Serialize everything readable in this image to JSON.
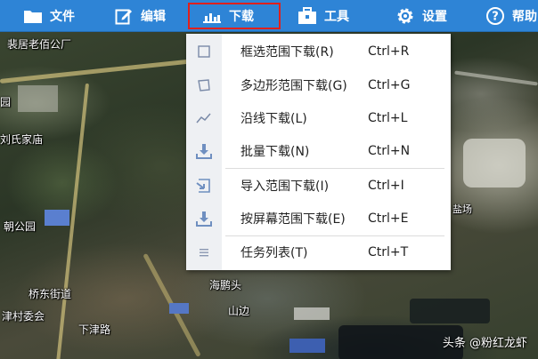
{
  "toolbar": {
    "items": [
      {
        "label": "文件",
        "icon": "folder-icon"
      },
      {
        "label": "编辑",
        "icon": "edit-icon"
      },
      {
        "label": "下载",
        "icon": "download-chart-icon",
        "active": true
      },
      {
        "label": "工具",
        "icon": "toolbox-icon"
      },
      {
        "label": "设置",
        "icon": "gear-icon"
      },
      {
        "label": "帮助",
        "icon": "help-icon"
      }
    ],
    "color": "#2e84d6",
    "highlight_color": "#e0201c"
  },
  "download_menu": {
    "items": [
      {
        "label": "框选范围下载(R)",
        "shortcut": "Ctrl+R",
        "icon": "rectangle-select-icon"
      },
      {
        "label": "多边形范围下载(G)",
        "shortcut": "Ctrl+G",
        "icon": "polygon-select-icon"
      },
      {
        "label": "沿线下载(L)",
        "shortcut": "Ctrl+L",
        "icon": "polyline-icon"
      },
      {
        "label": "批量下载(N)",
        "shortcut": "Ctrl+N",
        "icon": "batch-download-icon"
      },
      {
        "label": "导入范围下载(I)",
        "shortcut": "Ctrl+I",
        "icon": "import-range-icon"
      },
      {
        "label": "按屏幕范围下载(E)",
        "shortcut": "Ctrl+E",
        "icon": "screen-download-icon"
      },
      {
        "label": "任务列表(T)",
        "shortcut": "Ctrl+T",
        "icon": "task-list-icon"
      }
    ]
  },
  "map": {
    "labels": [
      "裴居老佰公厂",
      "园",
      "刘氏家庙",
      "朝公园",
      "桥东街道",
      "津村委会",
      "下津路",
      "海鹏头",
      "山边",
      "盐场"
    ]
  },
  "watermark": "头条 @粉红龙虾"
}
